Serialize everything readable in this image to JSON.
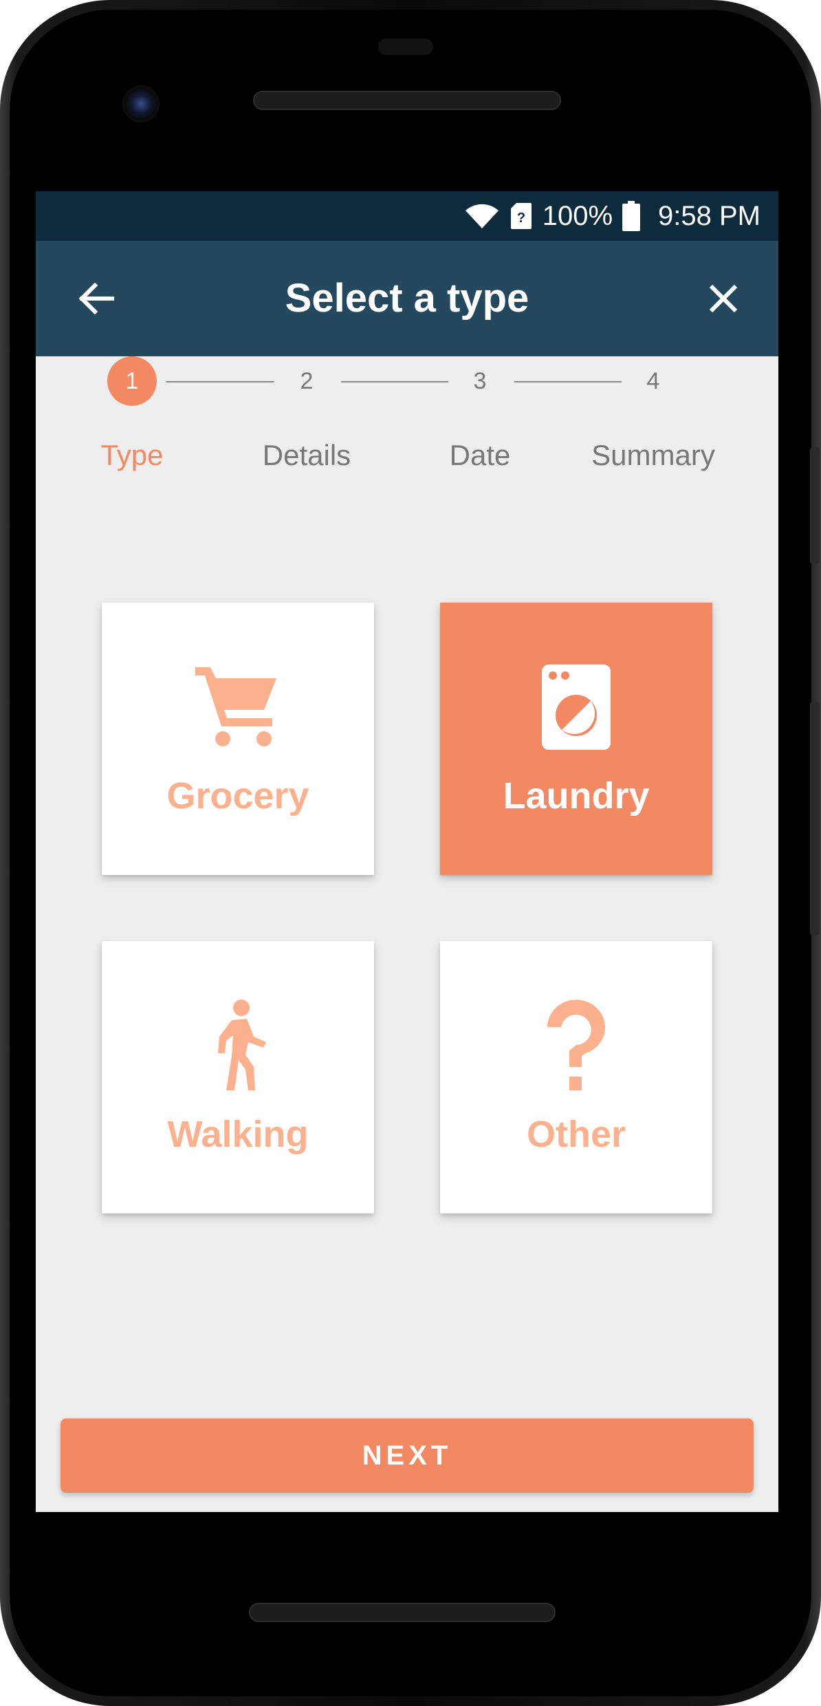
{
  "status_bar": {
    "battery_percent": "100%",
    "time": "9:58 PM",
    "icons": [
      "wifi-icon",
      "sim-card-unknown-icon",
      "battery-icon"
    ]
  },
  "app_bar": {
    "title": "Select a type",
    "back_icon": "arrow-left-icon",
    "close_icon": "close-icon"
  },
  "stepper": {
    "active_step": 1,
    "steps": [
      {
        "number": "1",
        "label": "Type"
      },
      {
        "number": "2",
        "label": "Details"
      },
      {
        "number": "3",
        "label": "Date"
      },
      {
        "number": "4",
        "label": "Summary"
      }
    ]
  },
  "types": [
    {
      "label": "Grocery",
      "icon": "shopping-cart-icon",
      "selected": false
    },
    {
      "label": "Laundry",
      "icon": "washing-machine-icon",
      "selected": true
    },
    {
      "label": "Walking",
      "icon": "walking-person-icon",
      "selected": false
    },
    {
      "label": "Other",
      "icon": "question-mark-icon",
      "selected": false
    }
  ],
  "next_button": {
    "label": "NEXT"
  },
  "colors": {
    "status_bar": "#0e2a3d",
    "app_bar": "#24495f",
    "accent": "#f28962",
    "accent_light": "#fbb08e",
    "background": "#eeeeee",
    "step_inactive": "#777777"
  }
}
